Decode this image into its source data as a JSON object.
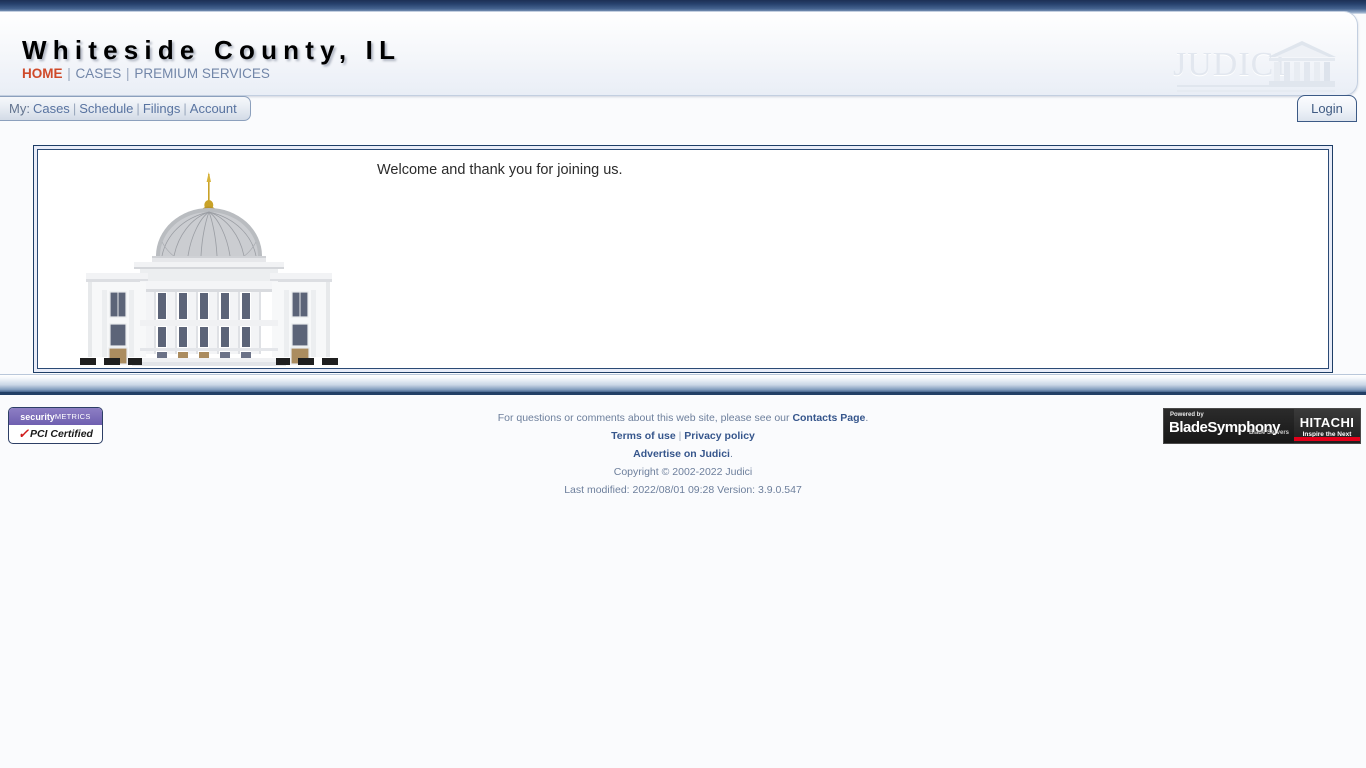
{
  "header": {
    "site_title": "Whiteside County, IL",
    "main_nav": [
      {
        "label": "HOME",
        "active": true
      },
      {
        "label": "CASES",
        "active": false
      },
      {
        "label": "PREMIUM SERVICES",
        "active": false
      }
    ],
    "logo": {
      "wordmark": "JUDICI",
      "icon": "courthouse-temple-icon"
    },
    "active_link_color": "#cf4a2a",
    "link_color": "#7286a8"
  },
  "mytabs": {
    "prefix": "My:",
    "items": [
      {
        "label": "Cases"
      },
      {
        "label": "Schedule"
      },
      {
        "label": "Filings"
      },
      {
        "label": "Account"
      }
    ]
  },
  "login": {
    "label": "Login"
  },
  "main": {
    "welcome_text": "Welcome and thank you for joining us.",
    "illustration": "county-courthouse-illustration"
  },
  "footer": {
    "line1_prefix": "For questions or comments about this web site, please see our ",
    "line1_link": "Contacts Page",
    "line1_suffix": ".",
    "terms_link": "Terms of use",
    "privacy_link": "Privacy policy",
    "advertise_link": "Advertise on Judici",
    "advertise_suffix": ".",
    "copyright": "Copyright © 2002-2022 Judici",
    "last_modified": "Last modified: 2022/08/01 09:28 Version: 3.9.0.547"
  },
  "badges": {
    "pci": {
      "brand_first": "security",
      "brand_second": "METRICS",
      "certified": "PCI Certified",
      "check": "✓"
    },
    "hitachi": {
      "powered_by": "Powered by",
      "blade_name": "BladeSymphony",
      "blade_sub": "Blade Servers",
      "hitachi_name": "HITACHI",
      "hitachi_tagline": "Inspire the Next",
      "accent_color": "#e2001a"
    }
  }
}
